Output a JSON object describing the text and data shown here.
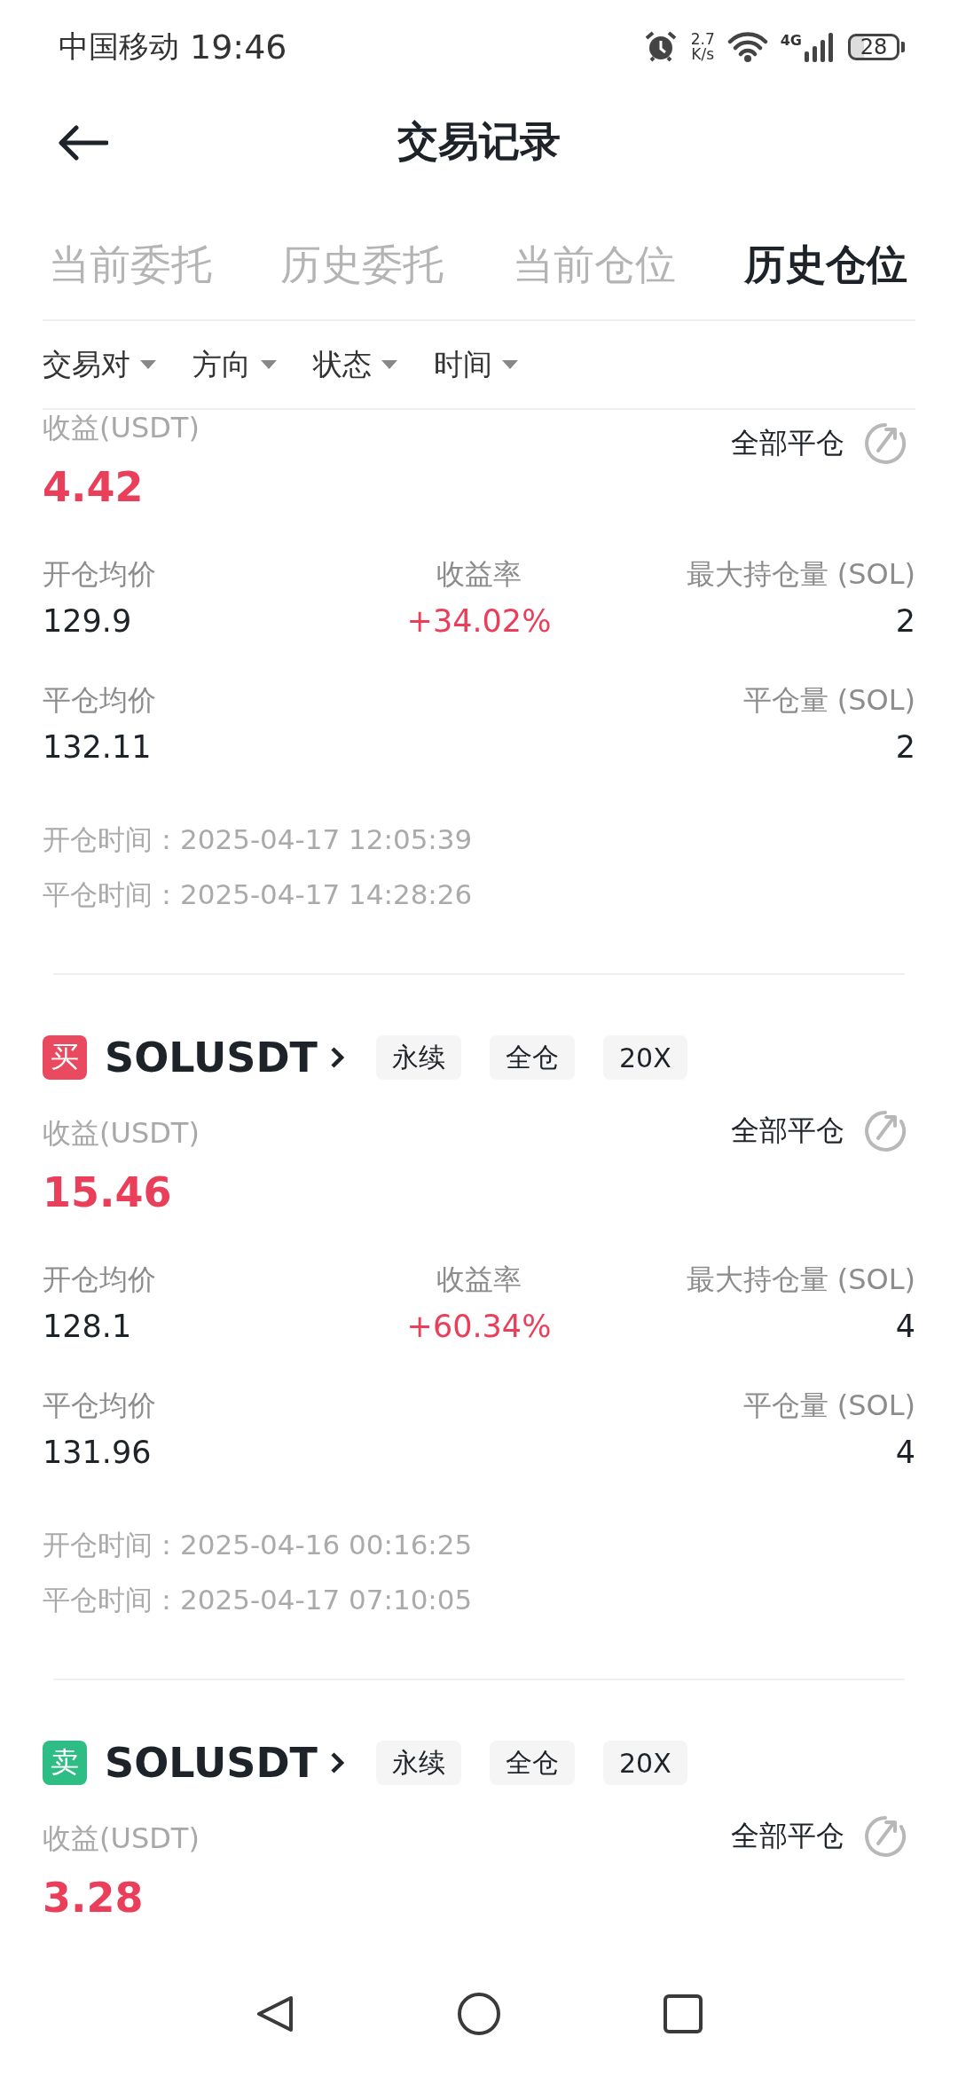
{
  "status_bar": {
    "carrier": "中国移动",
    "time": "19:46",
    "speed": "2.7",
    "speed_unit": "K/s",
    "network": "4G",
    "battery": "28"
  },
  "header": {
    "title": "交易记录"
  },
  "tabs": [
    {
      "label": "当前委托",
      "selected": false
    },
    {
      "label": "历史委托",
      "selected": false
    },
    {
      "label": "当前仓位",
      "selected": false
    },
    {
      "label": "历史仓位",
      "selected": true
    }
  ],
  "filters": [
    "交易对",
    "方向",
    "状态",
    "时间"
  ],
  "positions": [
    {
      "pnl_label": "收益(USDT)",
      "pnl": "4.42",
      "close_all": "全部平仓",
      "stats": {
        "open_price": [
          "开仓均价",
          "129.9"
        ],
        "roi": [
          "收益率",
          "+34.02%"
        ],
        "max_qty": [
          "最大持仓量 (SOL)",
          "2"
        ],
        "close_price": [
          "平仓均价",
          "132.11"
        ],
        "close_qty": [
          "平仓量 (SOL)",
          "2"
        ]
      },
      "times": [
        [
          "开仓时间：",
          "2025-04-17 12:05:39"
        ],
        [
          "平仓时间：",
          "2025-04-17 14:28:26"
        ]
      ]
    },
    {
      "kind": "buy",
      "side_label": "买",
      "symbol": "SOLUSDT",
      "tags": [
        "永续",
        "全仓",
        "20X"
      ],
      "pnl_label": "收益(USDT)",
      "pnl": "15.46",
      "close_all": "全部平仓",
      "stats": {
        "open_price": [
          "开仓均价",
          "128.1"
        ],
        "roi": [
          "收益率",
          "+60.34%"
        ],
        "max_qty": [
          "最大持仓量 (SOL)",
          "4"
        ],
        "close_price": [
          "平仓均价",
          "131.96"
        ],
        "close_qty": [
          "平仓量 (SOL)",
          "4"
        ]
      },
      "times": [
        [
          "开仓时间：",
          "2025-04-16 00:16:25"
        ],
        [
          "平仓时间：",
          "2025-04-17 07:10:05"
        ]
      ]
    },
    {
      "kind": "sell",
      "side_label": "卖",
      "symbol": "SOLUSDT",
      "tags": [
        "永续",
        "全仓",
        "20X"
      ],
      "pnl_label": "收益(USDT)",
      "pnl": "3.28",
      "close_all": "全部平仓"
    }
  ]
}
